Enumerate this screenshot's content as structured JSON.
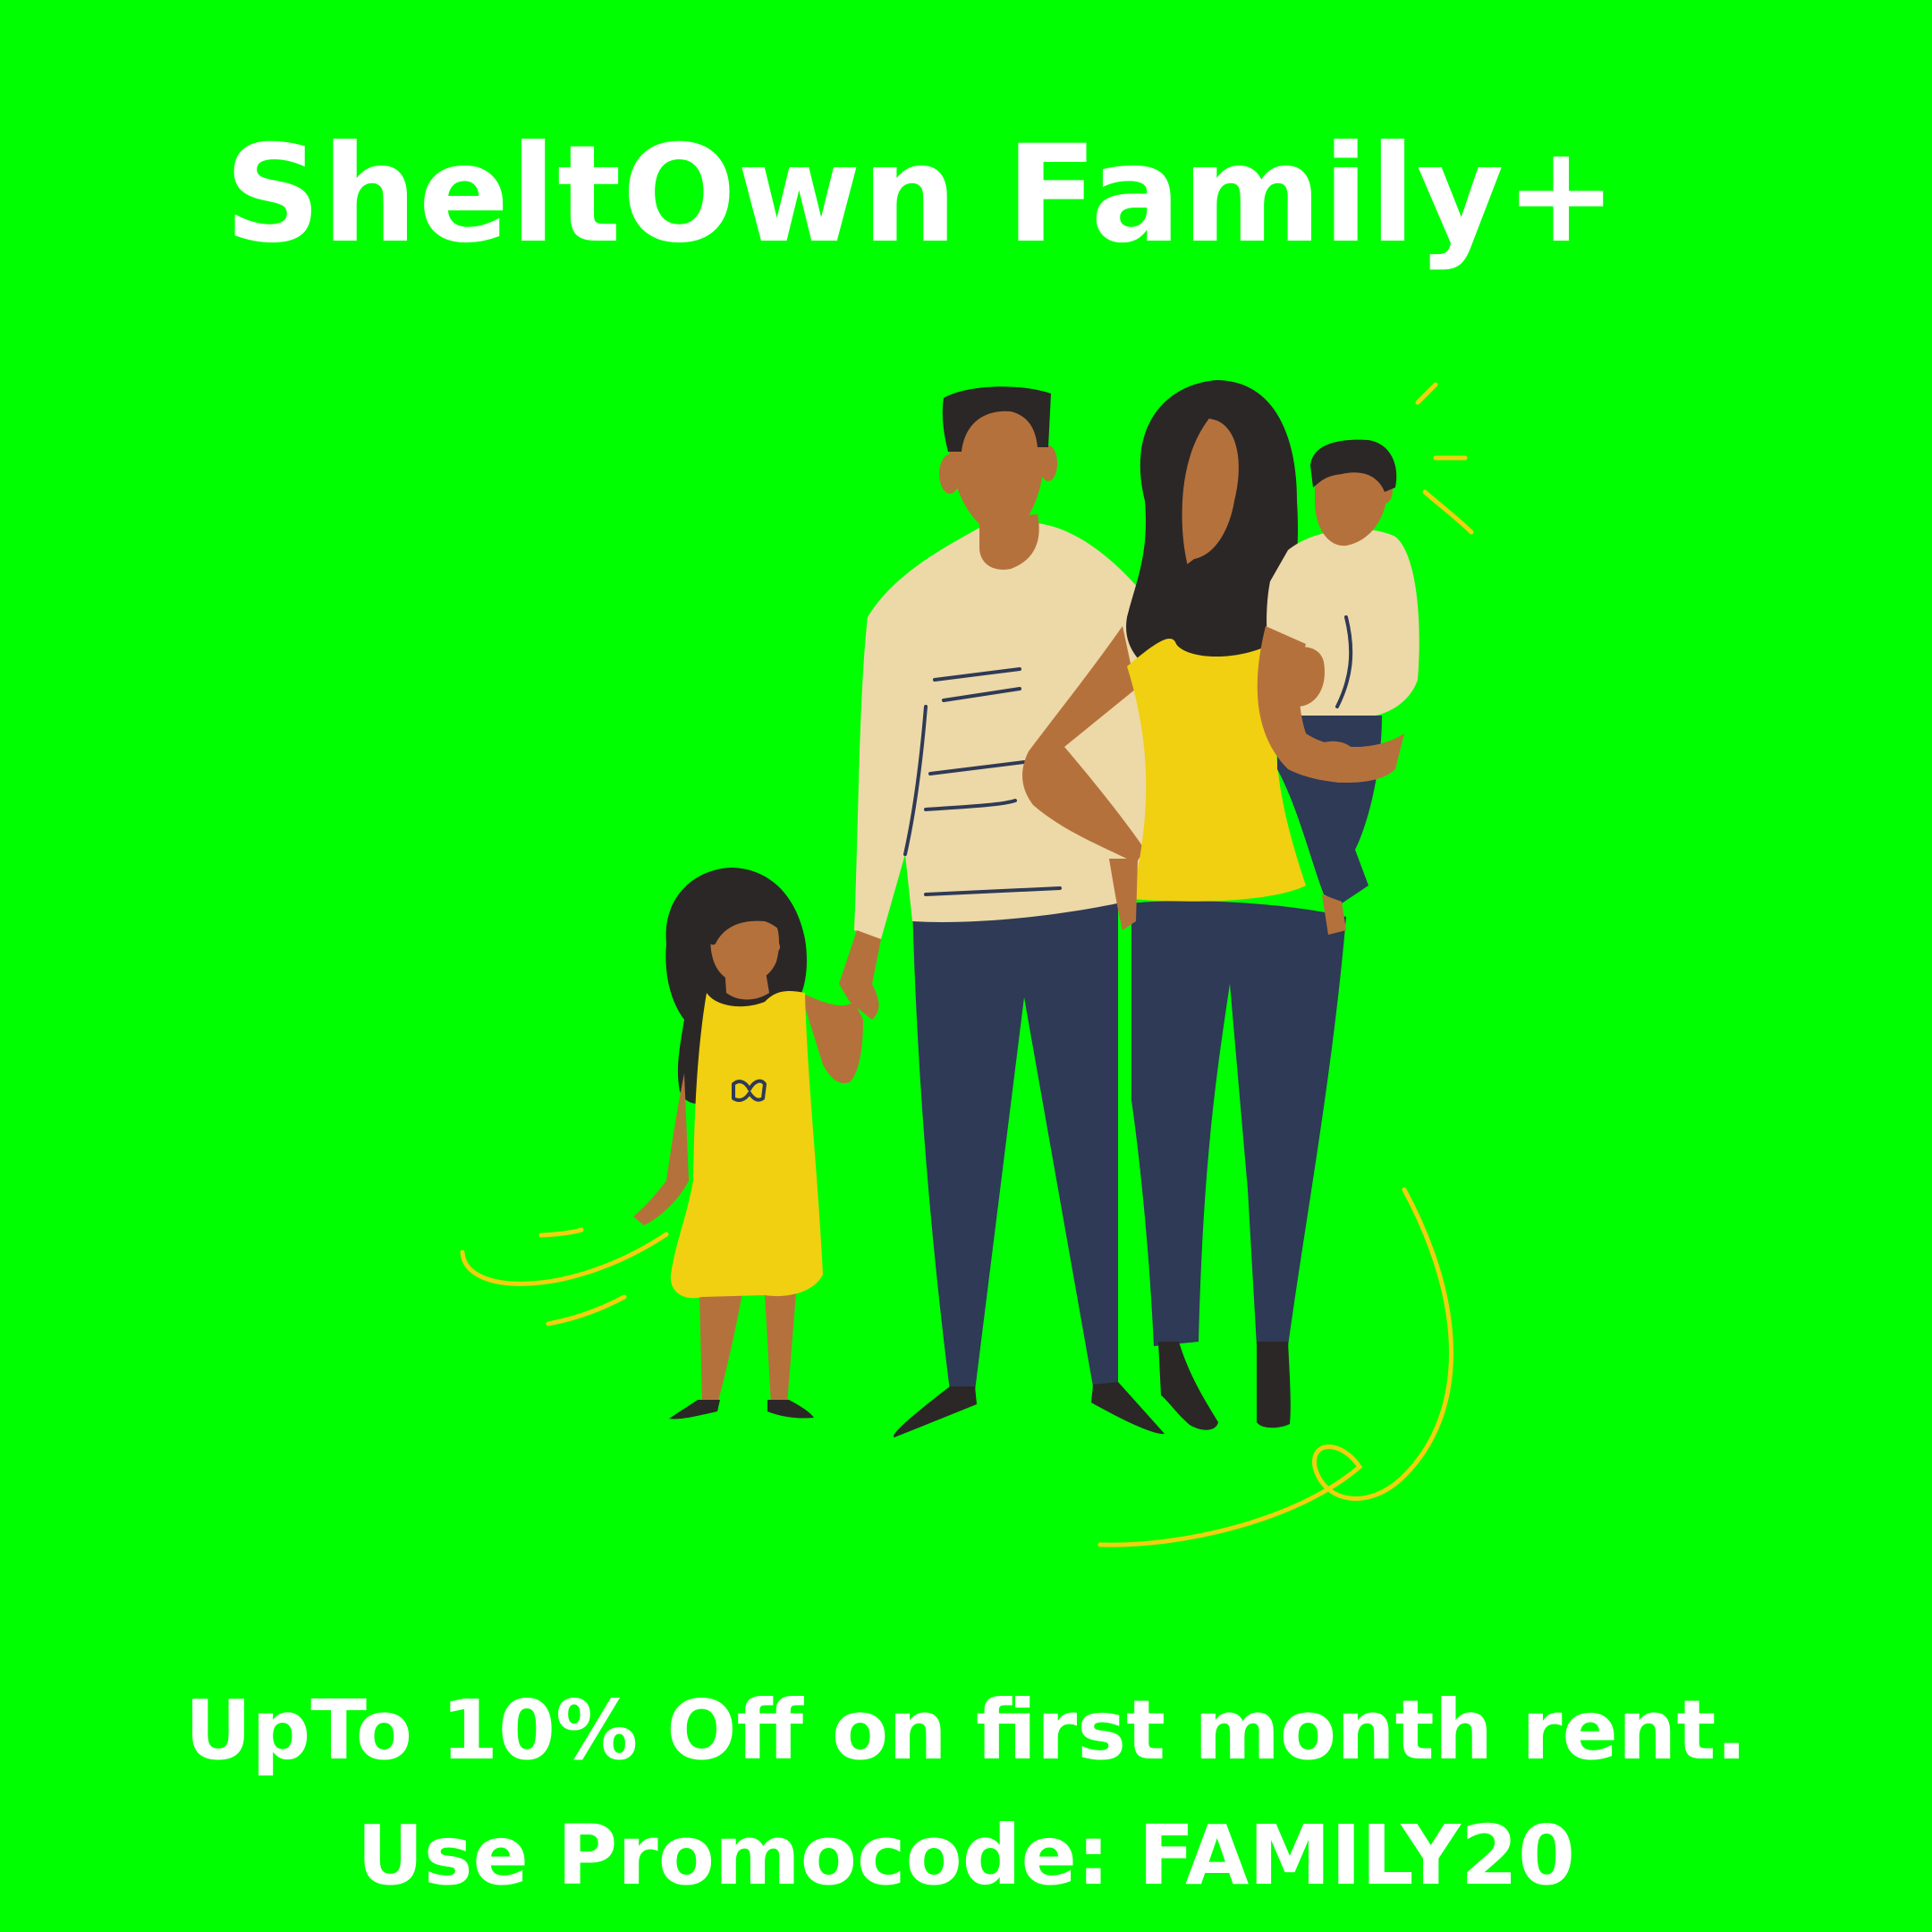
{
  "banner": {
    "title": "SheltOwn Family+",
    "offer_line": "UpTo 10% Off on first month rent.",
    "promo_line": "Use Promocode: FAMILY20"
  },
  "illustration": {
    "subject": "family-illustration",
    "figures": [
      "father-figure",
      "mother-figure",
      "child-girl-figure",
      "child-boy-figure"
    ]
  },
  "colors": {
    "background": "#00ff00",
    "text": "#ffffff",
    "yellow": "#f0d010",
    "navy": "#2e3a56",
    "cream": "#edd8a7",
    "skin": "#b5713c",
    "hair": "#2b2727"
  }
}
